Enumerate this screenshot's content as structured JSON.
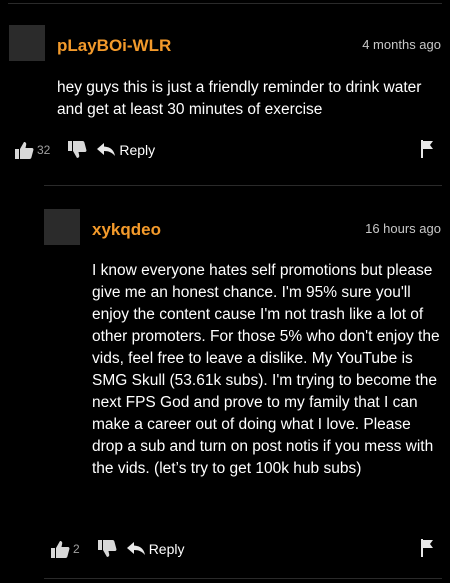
{
  "comments": [
    {
      "username": "pLayBOi-WLR",
      "time": "4 months ago",
      "text": "hey guys this is just a friendly reminder to drink water and get at least 30 minutes of exercise",
      "likes": "32",
      "reply_label": "Reply"
    },
    {
      "username": "xykqdeo",
      "time": "16 hours ago",
      "text": "I know everyone hates self promotions but please give me an honest chance. I'm 95% sure you'll enjoy the content cause I'm not trash like a lot of other promoters. For those 5% who don't enjoy the vids, feel free to leave a dislike. My YouTube is SMG Skull (53.61k subs). I'm trying to become the next FPS God and prove to my family that I can make a career out of doing what I love. Please drop a sub and turn on post notis if you mess with the vids. (let’s try to get 100k hub subs)",
      "likes": "2",
      "reply_label": "Reply"
    }
  ],
  "icons": {
    "like": "thumbs-up-icon",
    "dislike": "thumbs-down-icon",
    "reply": "reply-arrow-icon",
    "flag": "flag-icon"
  },
  "colors": {
    "background": "#000000",
    "username": "#f39a2b",
    "text": "#ffffff",
    "muted": "#c8c8c8"
  }
}
